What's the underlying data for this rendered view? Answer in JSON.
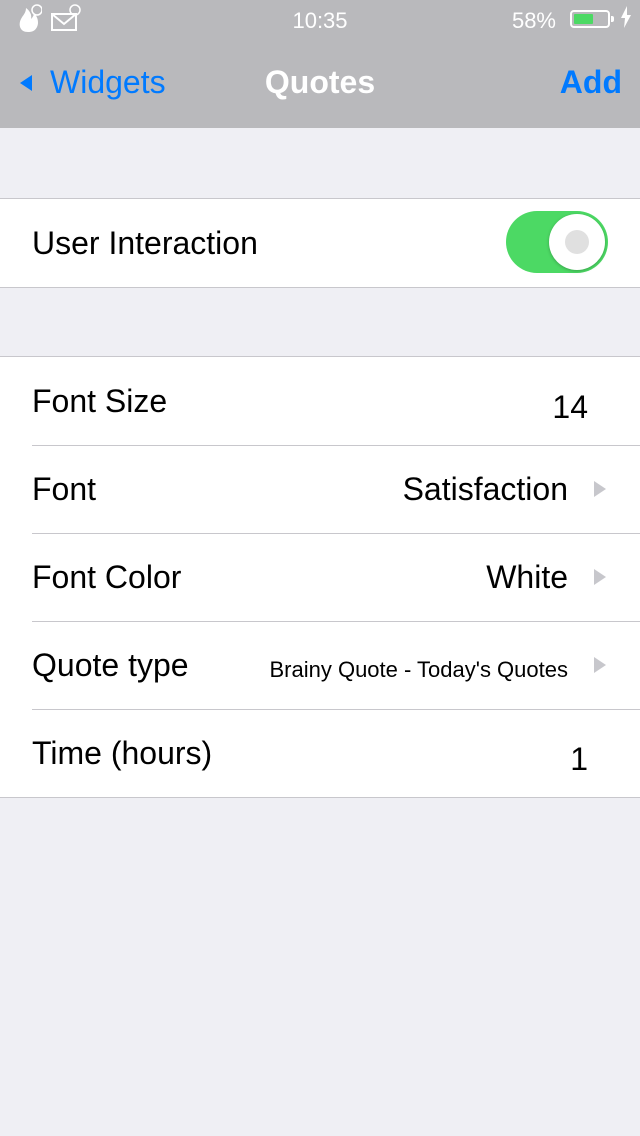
{
  "status_bar": {
    "time": "10:35",
    "battery_percent_label": "58%",
    "battery_level": 0.58,
    "icons": [
      "flame-icon",
      "mail-icon",
      "battery-icon",
      "charging-bolt-icon"
    ]
  },
  "nav": {
    "back_label": "Widgets",
    "title": "Quotes",
    "action_label": "Add"
  },
  "section1": {
    "user_interaction_label": "User Interaction",
    "user_interaction_on": true
  },
  "settings": {
    "font_size_label": "Font Size",
    "font_size_value": "14",
    "font_label": "Font",
    "font_value": "Satisfaction",
    "font_color_label": "Font Color",
    "font_color_value": "White",
    "quote_type_label": "Quote type",
    "quote_type_value": "Brainy Quote - Today's Quotes",
    "time_label": "Time (hours)",
    "time_value": "1"
  },
  "colors": {
    "accent": "#007aff",
    "toggle_on": "#4cd964",
    "nav_background": "#b9b9bc",
    "page_background": "#efeff4"
  }
}
